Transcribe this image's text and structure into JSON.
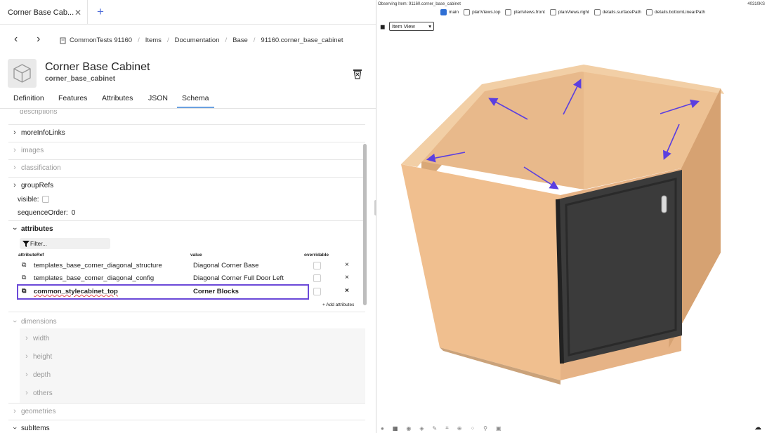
{
  "tab": {
    "title": "Corner Base Cab...",
    "close": "✕",
    "add": "+"
  },
  "breadcrumb": {
    "back": "‹",
    "forward": "›",
    "items": [
      "CommonTests 91160",
      "Items",
      "Documentation",
      "Base",
      "91160.corner_base_cabinet"
    ]
  },
  "item": {
    "title": "Corner Base Cabinet",
    "id": "corner_base_cabinet"
  },
  "tabs": [
    "Definition",
    "Features",
    "Attributes",
    "JSON",
    "Schema"
  ],
  "active_tab": "Schema",
  "schema": {
    "rows": [
      {
        "label": "descriptions",
        "dim": true
      },
      {
        "label": "moreInfoLinks",
        "dim": false
      },
      {
        "label": "images",
        "dim": true
      },
      {
        "label": "classification",
        "dim": true
      },
      {
        "label": "groupRefs",
        "dim": false
      }
    ],
    "visible_label": "visible:",
    "sequence_label": "sequenceOrder:",
    "sequence_value": "0",
    "attributes_label": "attributes",
    "filter_placeholder": "Filter...",
    "columns": {
      "ref": "attributeRef",
      "value": "value",
      "overridable": "overridable"
    },
    "attr_rows": [
      {
        "ref": "templates_base_corner_diagonal_structure",
        "value": "Diagonal Corner Base",
        "del": "×"
      },
      {
        "ref": "templates_base_corner_diagonal_config",
        "value": "Diagonal Corner Full Door Left",
        "del": "×"
      },
      {
        "ref": "common_stylecabinet_top",
        "value": "Corner Blocks",
        "del": "×"
      }
    ],
    "add_attr": "+ Add attributes",
    "dimensions_label": "dimensions",
    "dimension_children": [
      "width",
      "height",
      "depth",
      "others"
    ],
    "geometries_label": "geometries",
    "subitems_label": "subItems"
  },
  "viewer": {
    "observing": "Observing Item: 91160.corner_base_cabinet",
    "code": "40310KS",
    "toggles": [
      {
        "label": "main",
        "on": true
      },
      {
        "label": "planViews.top",
        "on": false
      },
      {
        "label": "planViews.front",
        "on": false
      },
      {
        "label": "planViews.right",
        "on": false
      },
      {
        "label": "details.surfacePath",
        "on": false
      },
      {
        "label": "details.bottomLinearPath",
        "on": false
      }
    ],
    "view_select": "Item View"
  },
  "colors": {
    "accent": "#6b49d8",
    "wood": "#eab98a",
    "door": "#3a3a3a",
    "link": "#4d6bd9"
  }
}
